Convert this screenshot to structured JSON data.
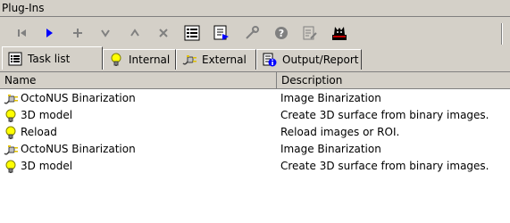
{
  "panel": {
    "title": "Plug-Ins"
  },
  "toolbar": {
    "buttons": [
      {
        "icon": "first-icon",
        "enabled": false
      },
      {
        "icon": "play-icon",
        "enabled": true
      },
      {
        "icon": "add-icon",
        "enabled": false
      },
      {
        "icon": "move-down-icon",
        "enabled": false
      },
      {
        "icon": "move-up-icon",
        "enabled": false
      },
      {
        "icon": "delete-icon",
        "enabled": false
      },
      {
        "icon": "task-list-icon",
        "enabled": true
      },
      {
        "icon": "export-icon",
        "enabled": true
      },
      {
        "icon": "settings-icon",
        "enabled": false
      },
      {
        "icon": "help-icon",
        "enabled": false
      },
      {
        "icon": "properties-icon",
        "enabled": false
      },
      {
        "icon": "plugin-logo-icon",
        "enabled": true
      }
    ]
  },
  "tabs": [
    {
      "label": "Task list",
      "icon": "list-icon",
      "active": true
    },
    {
      "label": "Internal",
      "icon": "lightbulb-icon",
      "active": false
    },
    {
      "label": "External",
      "icon": "plug-icon",
      "active": false
    },
    {
      "label": "Output/Report",
      "icon": "info-icon",
      "active": false
    }
  ],
  "list": {
    "columns": [
      "Name",
      "Description"
    ],
    "rows": [
      {
        "name": "OctoNUS Binarization",
        "description": "Image Binarization",
        "icon": "plug-icon"
      },
      {
        "name": "3D model",
        "description": "Create 3D surface from binary images.",
        "icon": "lightbulb-icon"
      },
      {
        "name": "Reload",
        "description": "Reload images or ROI.",
        "icon": "lightbulb-icon"
      },
      {
        "name": "OctoNUS Binarization",
        "description": "Image Binarization",
        "icon": "plug-icon"
      },
      {
        "name": "3D model",
        "description": "Create 3D surface from binary images.",
        "icon": "lightbulb-icon"
      }
    ]
  },
  "colors": {
    "chrome": "#d4d0c8",
    "disabled": "#808080",
    "accent": "#0000ff"
  }
}
